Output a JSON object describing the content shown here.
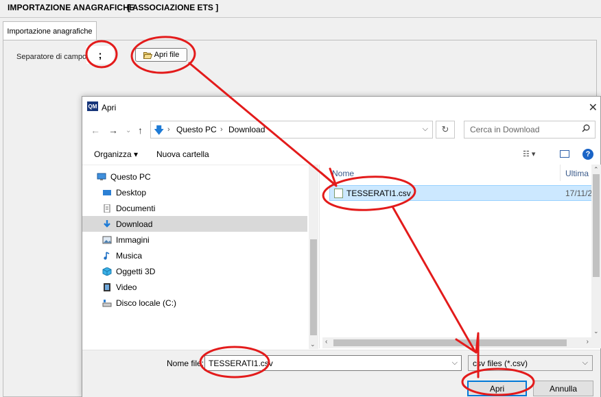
{
  "app": {
    "title": "IMPORTAZIONE ANAGRAFICHE",
    "subtitle": "[ ASSOCIAZIONE ETS ]"
  },
  "tabs": [
    {
      "label": "Importazione anagrafiche"
    }
  ],
  "form": {
    "separator_label": "Separatore di campo:",
    "separator_value": ";",
    "open_file_button": "Apri file"
  },
  "dialog": {
    "title": "Apri",
    "app_icon_text": "QM",
    "address": {
      "crumbs": [
        "Questo PC",
        "Download"
      ]
    },
    "search_placeholder": "Cerca in Download",
    "toolbar": {
      "organize_label": "Organizza ▾",
      "new_folder_label": "Nuova cartella"
    },
    "nav_items": [
      {
        "label": "Questo PC",
        "icon": "computer-icon"
      },
      {
        "label": "Desktop",
        "icon": "desktop-icon"
      },
      {
        "label": "Documenti",
        "icon": "documents-icon"
      },
      {
        "label": "Download",
        "icon": "download-icon",
        "selected": true
      },
      {
        "label": "Immagini",
        "icon": "images-icon"
      },
      {
        "label": "Musica",
        "icon": "music-icon"
      },
      {
        "label": "Oggetti 3D",
        "icon": "3d-objects-icon"
      },
      {
        "label": "Video",
        "icon": "video-icon"
      },
      {
        "label": "Disco locale (C:)",
        "icon": "disk-icon"
      }
    ],
    "columns": {
      "name": "Nome",
      "date": "Ultima m"
    },
    "files": [
      {
        "name": "TESSERATI1.csv",
        "date": "17/11/2"
      }
    ],
    "filename_label": "Nome file:",
    "filename_value": "TESSERATI1.csv",
    "file_type": "csv files (*.csv)",
    "open_button": "Apri",
    "cancel_button": "Annulla"
  },
  "annotation_color": "#e31b1b"
}
